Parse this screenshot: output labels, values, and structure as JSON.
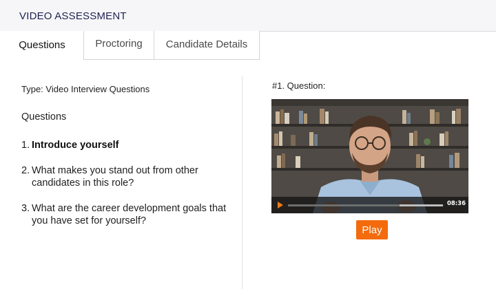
{
  "header": {
    "title": "VIDEO ASSESSMENT"
  },
  "tabs": [
    {
      "label": "Questions",
      "active": true
    },
    {
      "label": "Proctoring",
      "active": false
    },
    {
      "label": "Candidate Details",
      "active": false
    }
  ],
  "left": {
    "type_line": "Type: Video Interview Questions",
    "questions_heading": "Questions",
    "questions": [
      {
        "num": "1.",
        "text": "Introduce yourself"
      },
      {
        "num": "2.",
        "text": "What makes you stand out from other candidates in this role?"
      },
      {
        "num": "3.",
        "text": "What are the career development goals that you have set for yourself?"
      }
    ]
  },
  "right": {
    "question_label": "#1. Question:",
    "video": {
      "time": "08:36",
      "progress": 0.72,
      "accent_color": "#f07a1a"
    },
    "play_button_label": "Play"
  },
  "colors": {
    "header_bg": "#f6f6f8",
    "header_text": "#1e2152",
    "play_button": "#f36b0c"
  }
}
